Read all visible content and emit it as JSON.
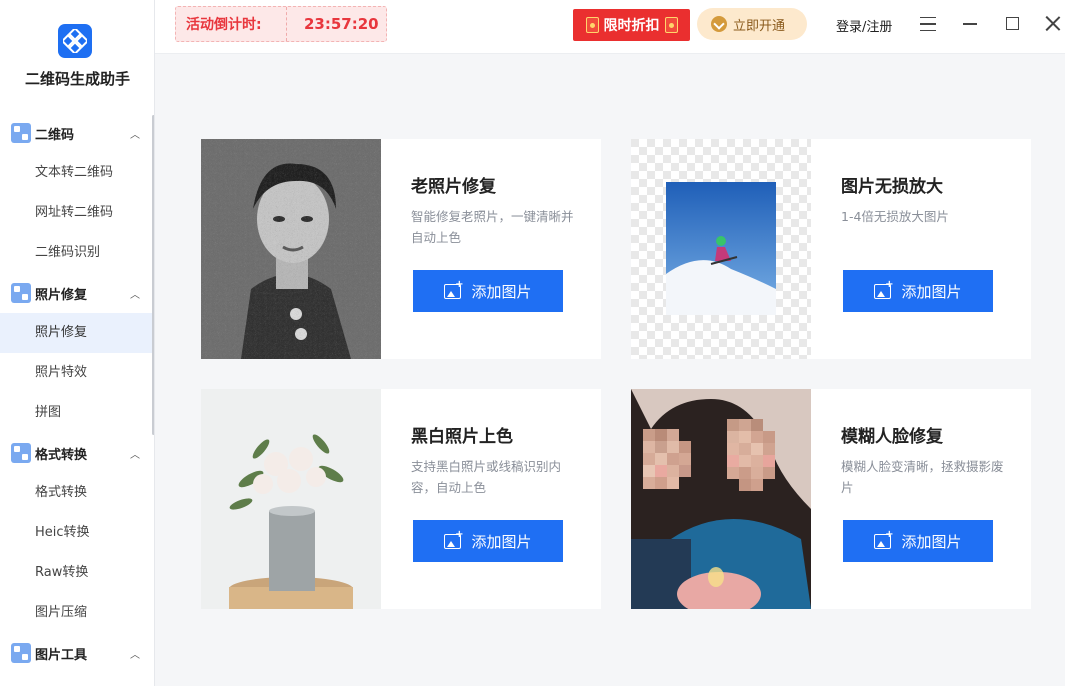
{
  "app": {
    "name": "二维码生成助手"
  },
  "sidebar": {
    "groups": [
      {
        "label": "二维码",
        "items": [
          "文本转二维码",
          "网址转二维码",
          "二维码识别"
        ]
      },
      {
        "label": "照片修复",
        "items": [
          "照片修复",
          "照片特效",
          "拼图"
        ]
      },
      {
        "label": "格式转换",
        "items": [
          "格式转换",
          "Heic转换",
          "Raw转换",
          "图片压缩"
        ]
      },
      {
        "label": "图片工具",
        "items": []
      }
    ],
    "active_item": "照片修复"
  },
  "topbar": {
    "countdown_label": "活动倒计时:",
    "countdown_time": "23:57:20",
    "promo_label": "限时折扣",
    "vip_label": "立即开通",
    "login_label": "登录/注册"
  },
  "cards": [
    {
      "title": "老照片修复",
      "desc": "智能修复老照片，一键清晰并自动上色",
      "button": "添加图片"
    },
    {
      "title": "图片无损放大",
      "desc": "1-4倍无损放大图片",
      "button": "添加图片"
    },
    {
      "title": "黑白照片上色",
      "desc": "支持黑白照片或线稿识别内容，自动上色",
      "button": "添加图片"
    },
    {
      "title": "模糊人脸修复",
      "desc": "模糊人脸变清晰，拯救摄影废片",
      "button": "添加图片"
    }
  ],
  "colors": {
    "accent": "#1f6ff3",
    "promo": "#ea2f2f",
    "countdown": "#e8363d"
  }
}
